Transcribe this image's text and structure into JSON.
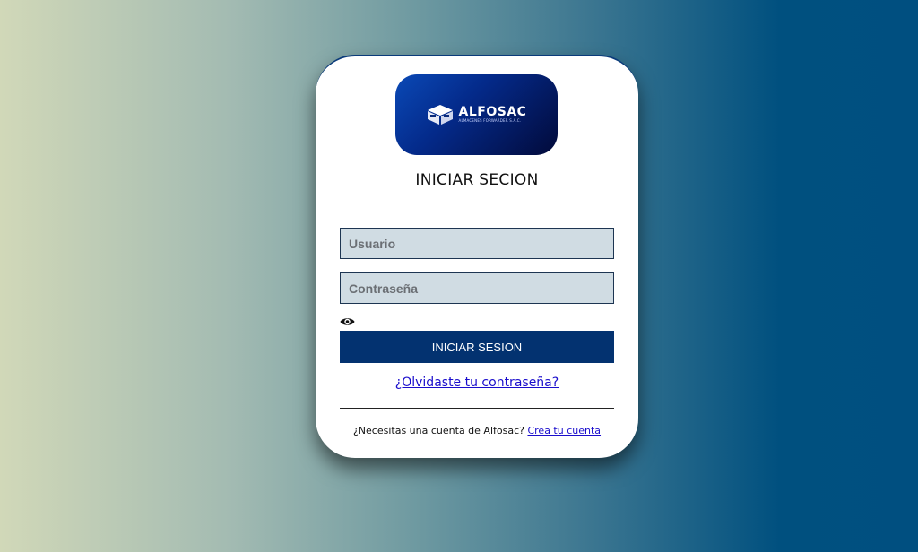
{
  "colors": {
    "card_background": "#ffffff",
    "logo_gradient_start": "#0a49b6",
    "logo_gradient_end": "#020a3a",
    "input_background": "#d0dce3",
    "input_border": "#1d3552",
    "button_background": "#033270",
    "button_text": "#ffffff",
    "link": "#1a0dcc"
  },
  "logo": {
    "name": "ALFOSAC",
    "subtitle": "ALMACENES FORWARDER S.A.C.",
    "icon": "box-logo-icon"
  },
  "form": {
    "title": "INICIAR SECION",
    "username": {
      "placeholder": "Usuario",
      "value": ""
    },
    "password": {
      "placeholder": "Contraseña",
      "value": "",
      "toggle_icon": "eye-icon"
    },
    "submit_label": "INICIAR SESION",
    "forgot_label": "¿Olvidaste tu contraseña?"
  },
  "signup": {
    "prompt": "¿Necesitas una cuenta de Alfosac?",
    "link_label": "Crea tu cuenta"
  }
}
